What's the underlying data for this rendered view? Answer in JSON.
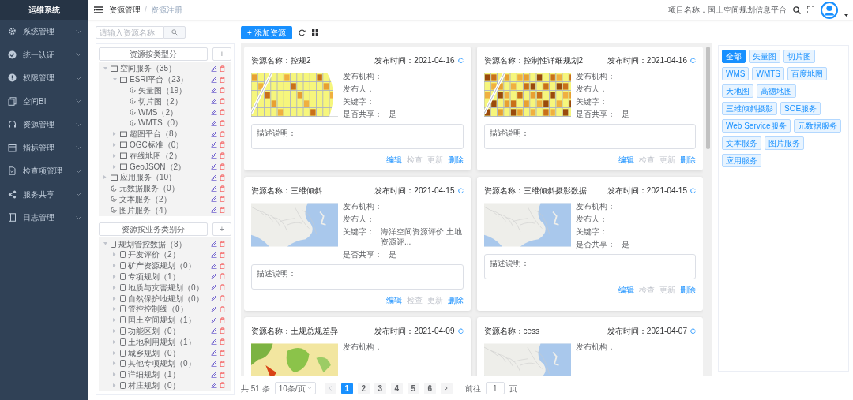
{
  "sidebar": {
    "title": "运维系统",
    "items": [
      {
        "label": "系统管理"
      },
      {
        "label": "统一认证"
      },
      {
        "label": "权限管理"
      },
      {
        "label": "空间BI"
      },
      {
        "label": "资源管理"
      },
      {
        "label": "指标管理"
      },
      {
        "label": "检查项管理"
      },
      {
        "label": "服务共享"
      },
      {
        "label": "日志管理"
      }
    ]
  },
  "topbar": {
    "breadcrumb": [
      "资源管理",
      "资源注册"
    ],
    "breadcrumb_separator": "/",
    "project": "项目名称：国土空间规划信息平台"
  },
  "toolbar": {
    "search_placeholder": "请输入资源名称",
    "add_button": "+ 添加资源"
  },
  "trees": [
    {
      "header": "资源按类型分",
      "add": "+",
      "nodes": [
        {
          "label": "空间服务（35）",
          "kind": "folder",
          "expanded": true,
          "children": [
            {
              "label": "ESRI平台（23）",
              "kind": "folder",
              "expanded": true,
              "children": [
                {
                  "label": "矢量图（19）",
                  "kind": "service"
                },
                {
                  "label": "切片图（2）",
                  "kind": "service"
                },
                {
                  "label": "WMS（2）",
                  "kind": "service"
                },
                {
                  "label": "WMTS（0）",
                  "kind": "service"
                }
              ]
            },
            {
              "label": "超图平台（8）",
              "kind": "folder",
              "expanded": false
            },
            {
              "label": "OGC标准（0）",
              "kind": "folder",
              "expanded": false
            },
            {
              "label": "在线地图（2）",
              "kind": "folder",
              "expanded": false
            },
            {
              "label": "GeoJSON（2）",
              "kind": "folder",
              "expanded": false
            }
          ]
        },
        {
          "label": "应用服务（10）",
          "kind": "folder",
          "expanded": false
        },
        {
          "label": "元数据服务（0）",
          "kind": "service"
        },
        {
          "label": "文本服务（2）",
          "kind": "service"
        },
        {
          "label": "图片服务（4）",
          "kind": "service"
        }
      ]
    },
    {
      "header": "资源按业务类别分",
      "add": "+",
      "nodes": [
        {
          "label": "规划管控数据（8）",
          "kind": "doc",
          "expanded": true,
          "children": [
            {
              "label": "开发评价（2）",
              "kind": "doc",
              "expanded": false
            },
            {
              "label": "矿产资源规划（0）",
              "kind": "doc",
              "expanded": false
            },
            {
              "label": "专项规划（1）",
              "kind": "doc",
              "expanded": false
            },
            {
              "label": "地质与灾害规划（0）",
              "kind": "doc",
              "expanded": false
            },
            {
              "label": "自然保护地规划（0）",
              "kind": "doc",
              "expanded": false
            },
            {
              "label": "管控控制线（0）",
              "kind": "doc",
              "expanded": false
            },
            {
              "label": "国土空间规划（1）",
              "kind": "doc",
              "expanded": false
            },
            {
              "label": "功能区划（0）",
              "kind": "doc",
              "expanded": false
            },
            {
              "label": "土地利用规划（1）",
              "kind": "doc",
              "expanded": false
            },
            {
              "label": "城乡规划（0）",
              "kind": "doc",
              "expanded": false
            },
            {
              "label": "其他专项规划（0）",
              "kind": "doc",
              "expanded": false
            },
            {
              "label": "详细规划（1）",
              "kind": "doc",
              "expanded": false
            },
            {
              "label": "村庄规划（0）",
              "kind": "doc",
              "expanded": false
            }
          ]
        }
      ]
    }
  ],
  "cards": [
    {
      "title": "资源名称：控规2",
      "published": "发布时间：2021-04-16",
      "fields": [
        {
          "label": "发布机构："
        },
        {
          "label": "发布人："
        },
        {
          "label": "关键字："
        },
        {
          "label": "是否共享：",
          "value": "是"
        }
      ],
      "description": "描述说明：",
      "actions": [
        {
          "label": "编辑",
          "disabled": false
        },
        {
          "label": "检查",
          "disabled": true
        },
        {
          "label": "更新",
          "disabled": true
        },
        {
          "label": "删除",
          "disabled": false
        }
      ]
    },
    {
      "title": "资源名称：控制性详细规划2",
      "published": "发布时间：2021-04-16",
      "fields": [
        {
          "label": "发布机构："
        },
        {
          "label": "发布人："
        },
        {
          "label": "关键字："
        },
        {
          "label": "是否共享：",
          "value": "是"
        }
      ],
      "description": "描述说明：",
      "actions": [
        {
          "label": "编辑",
          "disabled": false
        },
        {
          "label": "检查",
          "disabled": true
        },
        {
          "label": "更新",
          "disabled": true
        },
        {
          "label": "删除",
          "disabled": false
        }
      ]
    },
    {
      "title": "资源名称：三维倾斜",
      "published": "发布时间：2021-04-15",
      "fields": [
        {
          "label": "发布机构："
        },
        {
          "label": "发布人："
        },
        {
          "label": "关键字：",
          "value": "海洋空间资源评价,土地资源评..."
        },
        {
          "label": "是否共享：",
          "value": "是"
        }
      ],
      "description": "描述说明：",
      "actions": [
        {
          "label": "编辑",
          "disabled": false
        },
        {
          "label": "检查",
          "disabled": true
        },
        {
          "label": "更新",
          "disabled": true
        },
        {
          "label": "删除",
          "disabled": false
        }
      ]
    },
    {
      "title": "资源名称：三维倾斜摄影数据",
      "published": "发布时间：2021-04-15",
      "fields": [
        {
          "label": "发布机构："
        },
        {
          "label": "发布人："
        },
        {
          "label": "关键字："
        },
        {
          "label": "是否共享：",
          "value": "是"
        }
      ],
      "description": "描述说明：",
      "actions": [
        {
          "label": "编辑",
          "disabled": false
        },
        {
          "label": "检查",
          "disabled": true
        },
        {
          "label": "更新",
          "disabled": true
        },
        {
          "label": "删除",
          "disabled": false
        }
      ]
    },
    {
      "title": "资源名称：土规总规差异",
      "published": "发布时间：2021-04-09",
      "fields": [
        {
          "label": "发布机构："
        }
      ]
    },
    {
      "title": "资源名称：cess",
      "published": "发布时间：2021-04-07",
      "fields": [
        {
          "label": "发布机构："
        }
      ]
    }
  ],
  "pagination": {
    "total": "共 51 条",
    "page_size": "10条/页",
    "pages": [
      {
        "label": "1",
        "selected": true
      },
      {
        "label": "2",
        "selected": false
      },
      {
        "label": "3",
        "selected": false
      },
      {
        "label": "4",
        "selected": false
      },
      {
        "label": "5",
        "selected": false
      },
      {
        "label": "6",
        "selected": false
      }
    ],
    "goto_label": "前往",
    "goto_value": "1",
    "goto_suffix": "页"
  },
  "filters": [
    {
      "label": "全部",
      "selected": true
    },
    {
      "label": "矢量图",
      "selected": false
    },
    {
      "label": "切片图",
      "selected": false
    },
    {
      "label": "WMS",
      "selected": false
    },
    {
      "label": "WMTS",
      "selected": false
    },
    {
      "label": "百度地图",
      "selected": false
    },
    {
      "label": "天地图",
      "selected": false
    },
    {
      "label": "高德地图",
      "selected": false
    },
    {
      "label": "三维倾斜摄影",
      "selected": false
    },
    {
      "label": "SOE服务",
      "selected": false
    },
    {
      "label": "Web Service服务",
      "selected": false
    },
    {
      "label": "元数据服务",
      "selected": false
    },
    {
      "label": "文本服务",
      "selected": false
    },
    {
      "label": "图片服务",
      "selected": false
    },
    {
      "label": "应用服务",
      "selected": false
    }
  ]
}
